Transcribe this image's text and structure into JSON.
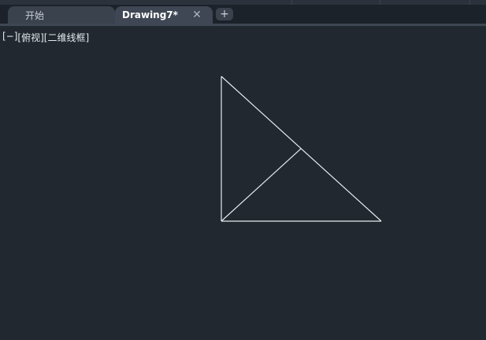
{
  "tabs": {
    "start_label": "开始",
    "drawing_label": "Drawing7*",
    "close_glyph": "✕",
    "new_tab_glyph": "+"
  },
  "viewport": {
    "minus_control": "[−]",
    "view_control": "[俯视]",
    "style_control": "[二维线框]"
  },
  "colors": {
    "canvas_background": "#212830",
    "drawing_lines": "#e8eaee"
  }
}
